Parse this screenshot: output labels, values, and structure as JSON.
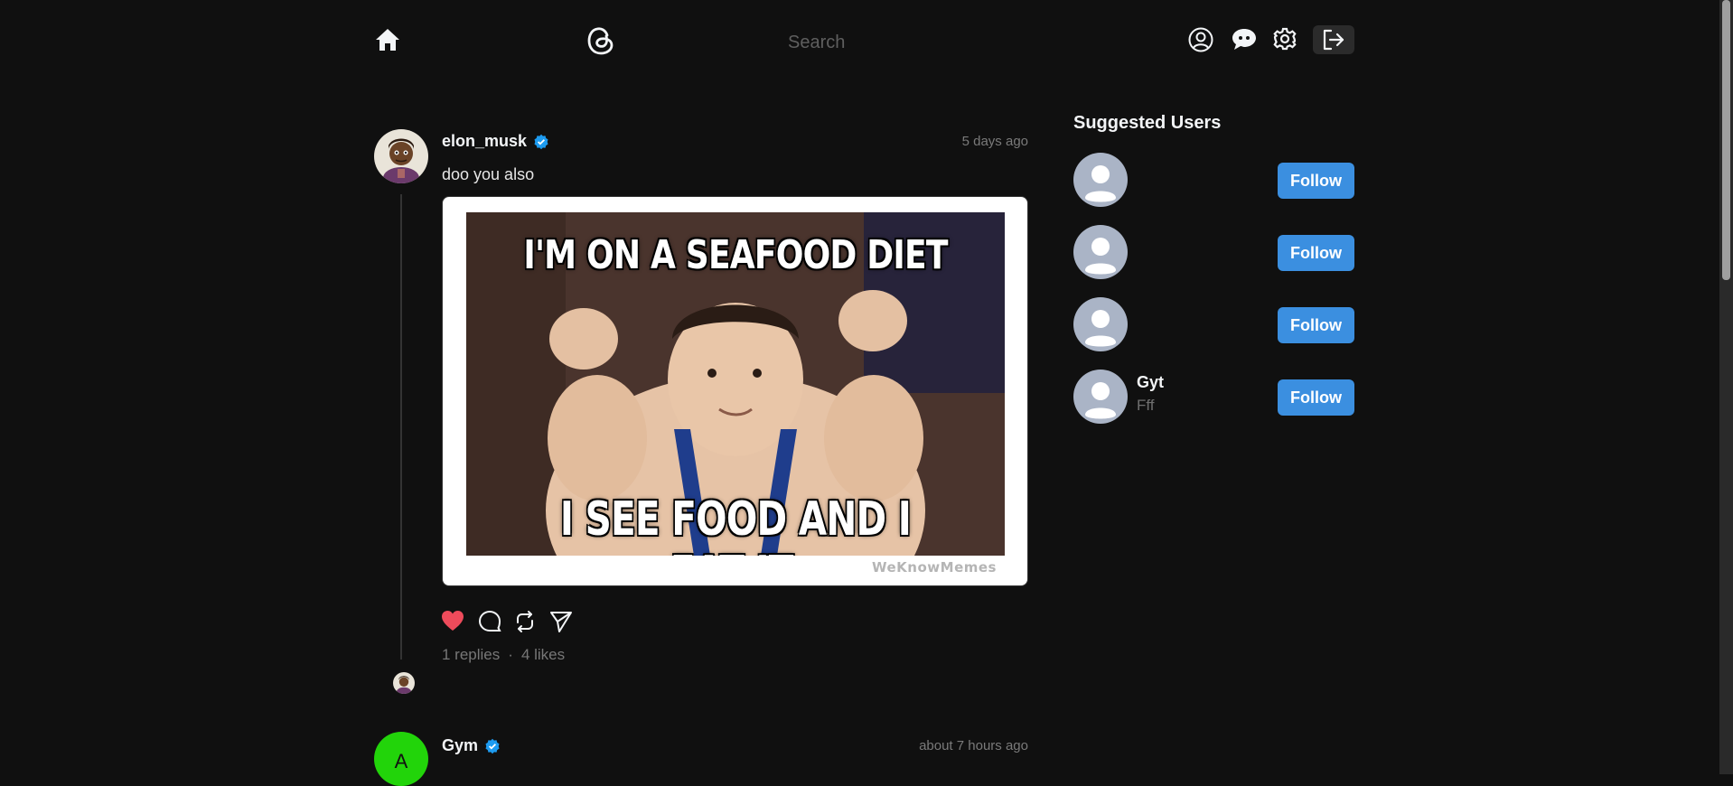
{
  "header": {
    "search_placeholder": "Search",
    "icons": [
      "home-icon",
      "threads-logo-icon",
      "profile-icon",
      "chat-icon",
      "settings-icon",
      "logout-icon"
    ]
  },
  "posts": [
    {
      "username": "elon_musk",
      "verified": true,
      "time": "5 days ago",
      "text": "doo you also",
      "media": {
        "top_caption": "I'M ON A SEAFOOD DIET",
        "bottom_caption": "I SEE FOOD AND I EAT IT.",
        "watermark": "WeKnowMemes"
      },
      "liked": true,
      "replies_text": "1 replies",
      "likes_text": "4 likes",
      "separator": "·"
    },
    {
      "username": "Gym",
      "avatar_letter": "A",
      "verified": true,
      "time": "about 7 hours ago"
    }
  ],
  "suggested": {
    "title": "Suggested Users",
    "users": [
      {
        "name": "",
        "sub": "",
        "button": "Follow"
      },
      {
        "name": "",
        "sub": "",
        "button": "Follow"
      },
      {
        "name": "",
        "sub": "",
        "button": "Follow"
      },
      {
        "name": "Gyt",
        "sub": "Fff",
        "button": "Follow"
      }
    ]
  },
  "colors": {
    "background": "#101010",
    "accent": "#3b8fe0",
    "like": "#ee4b5b",
    "verified": "#1d9bf0",
    "gym_avatar": "#22d40a"
  }
}
